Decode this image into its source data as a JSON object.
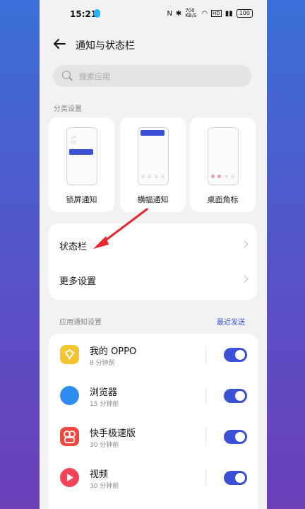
{
  "statusbar": {
    "time": "15:21",
    "signal_text": "700 KB/S",
    "battery": "100"
  },
  "header": {
    "title": "通知与状态栏"
  },
  "search": {
    "placeholder": "搜索应用"
  },
  "categories": {
    "label": "分类设置",
    "items": [
      {
        "label": "锁屏通知"
      },
      {
        "label": "横幅通知"
      },
      {
        "label": "桌面角标"
      }
    ]
  },
  "settings_group": {
    "rows": [
      {
        "label": "状态栏"
      },
      {
        "label": "更多设置"
      }
    ]
  },
  "app_section": {
    "label": "应用通知设置",
    "sort": "最近发送"
  },
  "apps": [
    {
      "name": "我的 OPPO",
      "time": "8 分钟前",
      "enabled": true,
      "color": "#f4c531"
    },
    {
      "name": "浏览器",
      "time": "15 分钟前",
      "enabled": true,
      "color": "#2f8cf0"
    },
    {
      "name": "快手极速版",
      "time": "30 分钟前",
      "enabled": true,
      "color": "#f5473b"
    },
    {
      "name": "视频",
      "time": "30 分钟前",
      "enabled": true,
      "color": "#f5435a"
    }
  ],
  "colors": {
    "accent": "#3a50d6",
    "annotation": "#e8282d"
  }
}
